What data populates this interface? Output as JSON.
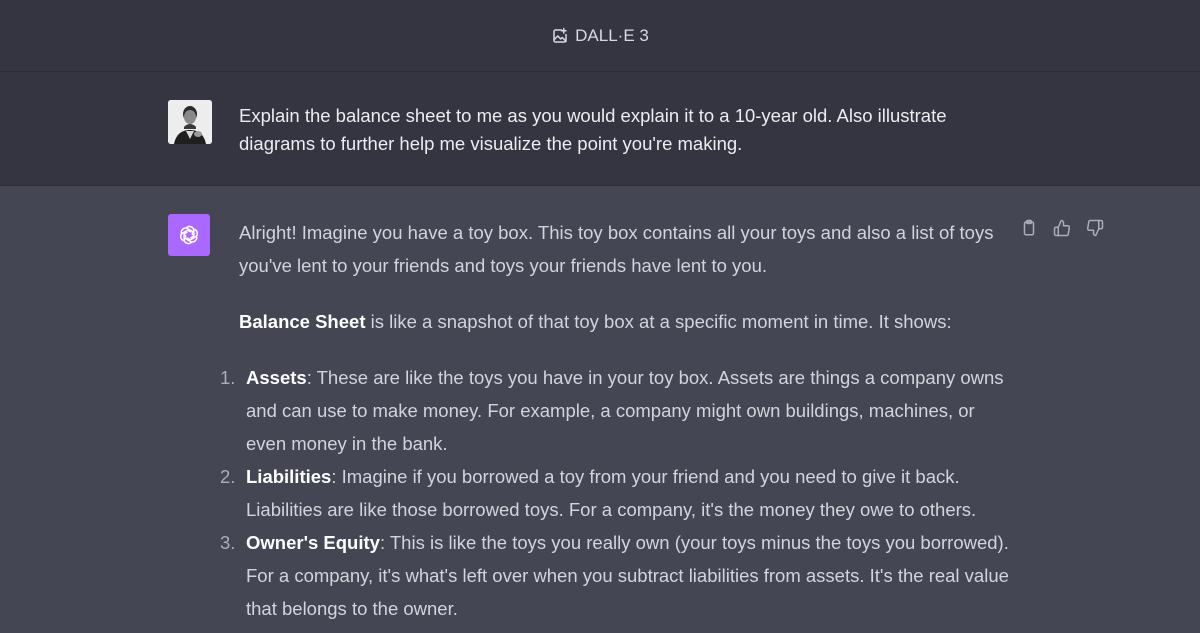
{
  "header": {
    "model_name": "DALL·E 3",
    "model_icon": "image-plus-icon"
  },
  "user_message": {
    "text": "Explain the balance sheet to me as you would explain it to a 10-year old. Also illustrate diagrams to further help me visualize the point you're making."
  },
  "assistant_message": {
    "intro": "Alright! Imagine you have a toy box. This toy box contains all your toys and also a list of toys you've lent to your friends and toys your friends have lent to you.",
    "balance_term": "Balance Sheet",
    "balance_rest": " is like a snapshot of that toy box at a specific moment in time. It shows:",
    "items": [
      {
        "num": "1.",
        "term": "Assets",
        "text": ": These are like the toys you have in your toy box. Assets are things a company owns and can use to make money. For example, a company might own buildings, machines, or even money in the bank."
      },
      {
        "num": "2.",
        "term": "Liabilities",
        "text": ": Imagine if you borrowed a toy from your friend and you need to give it back. Liabilities are like those borrowed toys. For a company, it's the money they owe to others."
      },
      {
        "num": "3.",
        "term": "Owner's Equity",
        "text": ": This is like the toys you really own (your toys minus the toys you borrowed). For a company, it's what's left over when you subtract liabilities from assets. It's the real value that belongs to the owner."
      }
    ]
  },
  "colors": {
    "page_bg": "#444654",
    "header_bg": "#343541",
    "bot_avatar": "#ab68ff"
  }
}
